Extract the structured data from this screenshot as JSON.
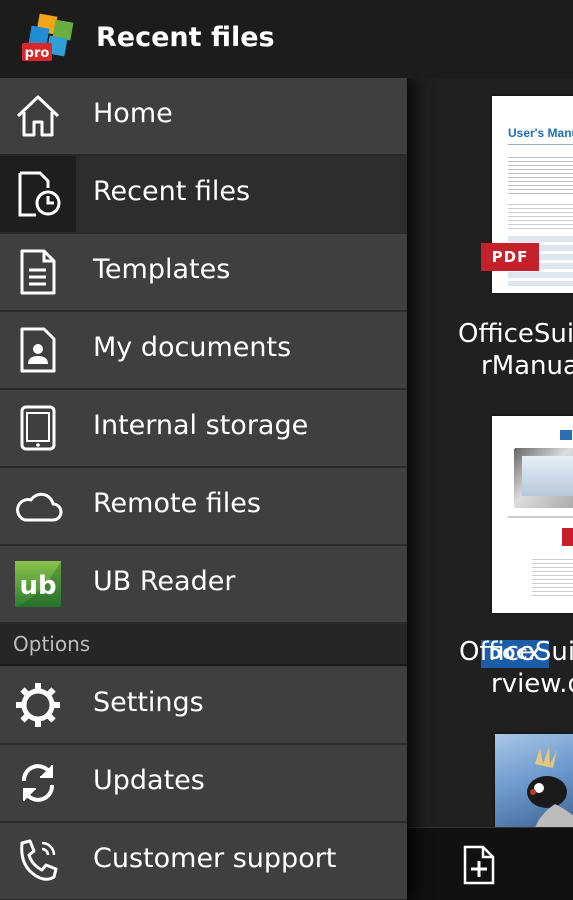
{
  "actionbar": {
    "title": "Recent files",
    "logo_badge": "pro"
  },
  "drawer": {
    "items": [
      {
        "label": "Home",
        "icon": "home-icon"
      },
      {
        "label": "Recent files",
        "icon": "recent-files-icon",
        "selected": true
      },
      {
        "label": "Templates",
        "icon": "templates-icon"
      },
      {
        "label": "My documents",
        "icon": "my-documents-icon"
      },
      {
        "label": "Internal storage",
        "icon": "tablet-icon"
      },
      {
        "label": "Remote files",
        "icon": "cloud-icon"
      },
      {
        "label": "UB Reader",
        "icon": "ub-reader-icon"
      }
    ],
    "options_header": "Options",
    "options": [
      {
        "label": "Settings",
        "icon": "gear-icon"
      },
      {
        "label": "Updates",
        "icon": "refresh-icon"
      },
      {
        "label": "Customer support",
        "icon": "phone-icon"
      }
    ]
  },
  "files": [
    {
      "badge": "PDF",
      "badge_color": "#c4212a",
      "name_line1": "OfficeSui",
      "name_line2": "rManua",
      "thumb_title": "User's Manua"
    },
    {
      "badge": "DOCX",
      "badge_color": "#1d5da8",
      "name_line1": "OfficeSui",
      "name_line2": "rview.d"
    },
    {
      "badge": "",
      "name_line1": "",
      "name_line2": ""
    }
  ],
  "bottombar": {
    "icon": "new-document-icon"
  }
}
